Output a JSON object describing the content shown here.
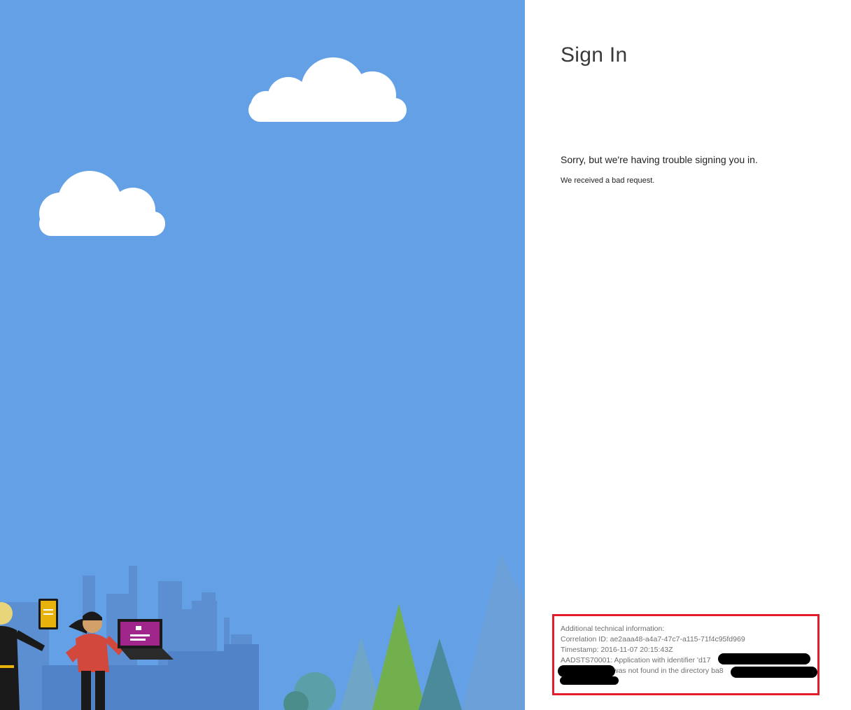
{
  "page": {
    "title": "Sign In",
    "error_heading": "Sorry, but we're having trouble signing you in.",
    "error_message": "We received a bad request."
  },
  "technical_info": {
    "header": "Additional technical information:",
    "correlation_id": "Correlation ID: ae2aaa48-a4a7-47c7-a115-71f4c95fd969",
    "timestamp": "Timestamp: 2016-11-07 20:15:43Z",
    "error_line_prefix": "AADSTS70001: Application with identifier 'd17",
    "error_line_suffix_a": "was not found in the directory ba8"
  },
  "colors": {
    "illustration_background": "#64a0e6",
    "highlight_border": "#e21c2a",
    "redaction": "#000000"
  }
}
